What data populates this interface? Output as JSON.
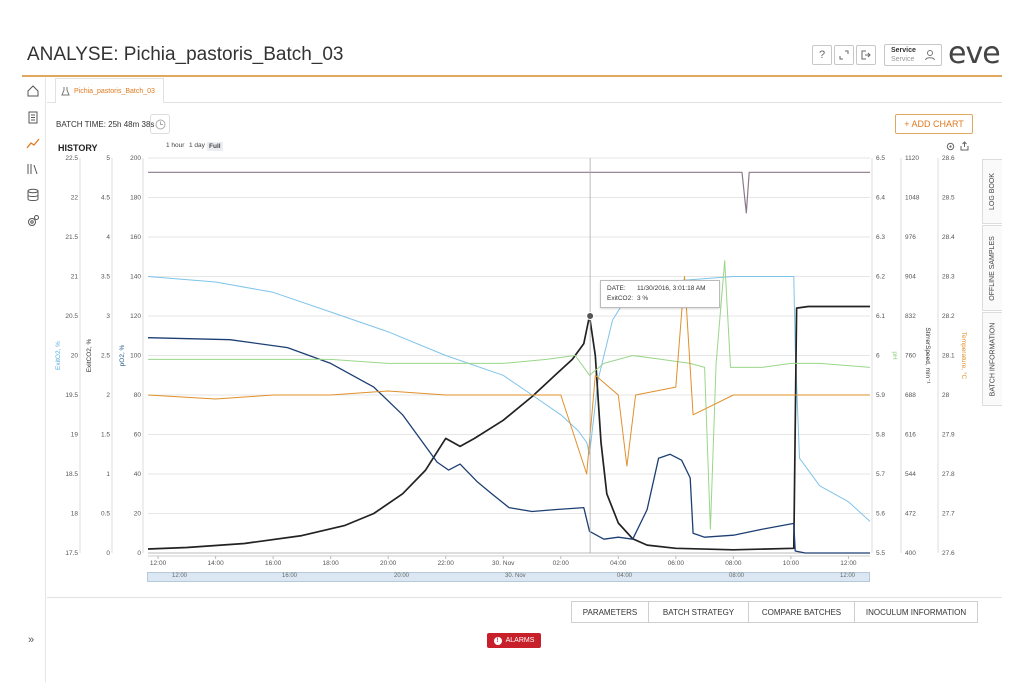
{
  "header": {
    "title": "ANALYSE: Pichia_pastoris_Batch_03",
    "help_label": "?",
    "user_name": "Service",
    "user_role": "Service",
    "logo": "eve",
    "accent_color": "#e0a85e"
  },
  "tabs": [
    {
      "label": "Pichia_pastoris_Batch_03"
    }
  ],
  "toolbar": {
    "batch_time": "BATCH TIME: 25h 48m 38s",
    "add_chart_label": "+ ADD CHART"
  },
  "chart_panel": {
    "title": "HISTORY",
    "ranges": [
      "1 hour",
      "1 day",
      "Full"
    ],
    "selected_range": "Full"
  },
  "tooltip": {
    "date_key": "DATE:",
    "date_value": "11/30/2016, 3:01:18 AM",
    "series_key": "ExitCO2:",
    "series_value": "3 %"
  },
  "side_tabs": [
    "LOG BOOK",
    "OFFLINE SAMPLES",
    "BATCH INFORMATION"
  ],
  "bottom_buttons": [
    "PARAMETERS",
    "BATCH STRATEGY",
    "COMPARE BATCHES",
    "INOCULUM INFORMATION"
  ],
  "alarms_label": "ALARMS",
  "chart_data": {
    "type": "line",
    "x_tick_labels": [
      "12:00",
      "14:00",
      "16:00",
      "18:00",
      "20:00",
      "22:00",
      "30. Nov",
      "02:00",
      "04:00",
      "06:00",
      "08:00",
      "10:00",
      "12:00"
    ],
    "x_ticks_hours": [
      12,
      14,
      16,
      18,
      20,
      22,
      24,
      26,
      28,
      30,
      32,
      34,
      36
    ],
    "x_range_hours": [
      11.65,
      36.75
    ],
    "navigator_labels": [
      "12:00",
      "16:00",
      "20:00",
      "30. Nov",
      "04:00",
      "08:00",
      "12:00"
    ],
    "axes": [
      {
        "id": "exito2",
        "label": "ExitO2, %",
        "color": "#5aaee0",
        "range": [
          17.5,
          22.5
        ],
        "ticks": [
          "17.5",
          "18",
          "18.5",
          "19",
          "19.5",
          "20",
          "20.5",
          "21",
          "21.5",
          "22",
          "22.5"
        ]
      },
      {
        "id": "exitco2",
        "label": "ExitCO2, %",
        "color": "#333333",
        "range": [
          0,
          5
        ],
        "ticks": [
          "0",
          "0.5",
          "1",
          "1.5",
          "2",
          "2.5",
          "3",
          "3.5",
          "4",
          "4.5",
          "5"
        ]
      },
      {
        "id": "po2",
        "label": "pO2, %",
        "color": "#2a5a8c",
        "range": [
          0,
          200
        ],
        "ticks": [
          "0",
          "20",
          "40",
          "60",
          "80",
          "100",
          "120",
          "140",
          "160",
          "180",
          "200"
        ]
      },
      {
        "id": "ph",
        "label": "pH",
        "color": "#8fd27a",
        "range": [
          5.5,
          6.5
        ],
        "ticks": [
          "5.5",
          "5.6",
          "5.7",
          "5.8",
          "5.9",
          "6",
          "6.1",
          "6.2",
          "6.3",
          "6.4",
          "6.5"
        ]
      },
      {
        "id": "stirrer",
        "label": "StirrerSpeed, min⁻¹",
        "color": "#333333",
        "range": [
          400,
          1120
        ],
        "ticks": [
          "400",
          "472",
          "544",
          "616",
          "688",
          "760",
          "832",
          "904",
          "976",
          "1048",
          "1120"
        ]
      },
      {
        "id": "temp",
        "label": "Temperature, °C",
        "color": "#e0902a",
        "range": [
          27.6,
          28.6
        ],
        "ticks": [
          "27.6",
          "27.7",
          "27.8",
          "27.9",
          "28",
          "28.1",
          "28.2",
          "28.3",
          "28.4",
          "28.5",
          "28.6"
        ]
      }
    ],
    "series": [
      {
        "name": "ExitO2",
        "axis": "exito2",
        "color": "#7fc4ea",
        "width": 1,
        "points": [
          [
            11.65,
            21.0
          ],
          [
            14,
            20.93
          ],
          [
            16,
            20.8
          ],
          [
            18,
            20.55
          ],
          [
            20,
            20.3
          ],
          [
            22,
            20.0
          ],
          [
            24,
            19.75
          ],
          [
            25,
            19.5
          ],
          [
            26,
            19.25
          ],
          [
            26.6,
            19.05
          ],
          [
            26.9,
            18.9
          ],
          [
            27.0,
            18.75
          ],
          [
            27.3,
            19.7
          ],
          [
            27.8,
            20.45
          ],
          [
            28.4,
            20.8
          ],
          [
            29.2,
            20.92
          ],
          [
            30.5,
            20.96
          ],
          [
            32,
            21.0
          ],
          [
            34.1,
            21.0
          ],
          [
            34.15,
            20.1
          ],
          [
            34.3,
            18.7
          ],
          [
            35.0,
            18.35
          ],
          [
            36.0,
            18.15
          ],
          [
            36.75,
            17.9
          ]
        ]
      },
      {
        "name": "ExitCO2",
        "axis": "exitco2",
        "color": "#222222",
        "width": 1.7,
        "points": [
          [
            11.65,
            0.05
          ],
          [
            13,
            0.07
          ],
          [
            15,
            0.12
          ],
          [
            17,
            0.22
          ],
          [
            18.5,
            0.35
          ],
          [
            19.5,
            0.5
          ],
          [
            20.5,
            0.75
          ],
          [
            21.3,
            1.05
          ],
          [
            22,
            1.45
          ],
          [
            22.5,
            1.35
          ],
          [
            23,
            1.45
          ],
          [
            24,
            1.68
          ],
          [
            25,
            1.98
          ],
          [
            25.8,
            2.25
          ],
          [
            26.4,
            2.45
          ],
          [
            26.8,
            2.65
          ],
          [
            27.0,
            3.0
          ],
          [
            27.2,
            2.5
          ],
          [
            27.4,
            1.4
          ],
          [
            27.6,
            0.75
          ],
          [
            28.0,
            0.38
          ],
          [
            28.5,
            0.18
          ],
          [
            29.0,
            0.1
          ],
          [
            30,
            0.06
          ],
          [
            32,
            0.04
          ],
          [
            34.1,
            0.06
          ],
          [
            34.2,
            3.1
          ],
          [
            34.6,
            3.12
          ],
          [
            36.75,
            3.12
          ]
        ]
      },
      {
        "name": "pO2",
        "axis": "po2",
        "color": "#1d3f73",
        "width": 1.3,
        "points": [
          [
            11.65,
            109
          ],
          [
            14.5,
            108
          ],
          [
            16.5,
            104
          ],
          [
            18,
            96
          ],
          [
            19.5,
            84
          ],
          [
            20.5,
            70
          ],
          [
            21.2,
            56
          ],
          [
            21.7,
            46
          ],
          [
            22.1,
            42
          ],
          [
            22.5,
            45
          ],
          [
            23.1,
            36
          ],
          [
            23.6,
            30
          ],
          [
            24.2,
            23
          ],
          [
            25,
            21
          ],
          [
            25.8,
            22
          ],
          [
            26.8,
            23
          ],
          [
            27.0,
            11
          ],
          [
            27.5,
            7
          ],
          [
            28.0,
            8
          ],
          [
            28.5,
            7
          ],
          [
            29.0,
            22
          ],
          [
            29.4,
            48
          ],
          [
            29.8,
            50
          ],
          [
            30.2,
            47
          ],
          [
            30.5,
            38
          ],
          [
            30.6,
            10
          ],
          [
            31,
            8
          ],
          [
            32,
            9
          ],
          [
            33,
            12
          ],
          [
            34.1,
            15
          ],
          [
            34.15,
            1
          ],
          [
            34.5,
            0
          ],
          [
            36.75,
            0
          ]
        ]
      },
      {
        "name": "pH",
        "axis": "ph",
        "color": "#9ad68a",
        "width": 1,
        "points": [
          [
            11.65,
            5.99
          ],
          [
            14,
            5.99
          ],
          [
            16,
            5.99
          ],
          [
            18,
            5.99
          ],
          [
            20,
            5.98
          ],
          [
            22,
            5.98
          ],
          [
            24,
            5.98
          ],
          [
            25.5,
            5.99
          ],
          [
            26.5,
            6.0
          ],
          [
            27.0,
            5.95
          ],
          [
            27.5,
            5.98
          ],
          [
            28.5,
            6.0
          ],
          [
            29.5,
            5.99
          ],
          [
            30.5,
            5.98
          ],
          [
            31.0,
            5.97
          ],
          [
            31.2,
            5.56
          ],
          [
            31.4,
            5.98
          ],
          [
            31.7,
            6.24
          ],
          [
            31.9,
            5.97
          ],
          [
            33,
            5.97
          ],
          [
            34,
            5.98
          ],
          [
            35,
            5.98
          ],
          [
            36.75,
            5.97
          ]
        ]
      },
      {
        "name": "StirrerSpeed",
        "axis": "stirrer",
        "color": "#8a7a8a",
        "width": 1.2,
        "points": [
          [
            11.65,
            1094
          ],
          [
            32.3,
            1094
          ],
          [
            32.45,
            1020
          ],
          [
            32.55,
            1094
          ],
          [
            36.75,
            1094
          ]
        ]
      },
      {
        "name": "Temperature",
        "axis": "temp",
        "color": "#e0902a",
        "width": 1,
        "points": [
          [
            11.65,
            28.0
          ],
          [
            14,
            27.99
          ],
          [
            16,
            28.0
          ],
          [
            18,
            28.0
          ],
          [
            20,
            28.01
          ],
          [
            22,
            28.0
          ],
          [
            24,
            28.0
          ],
          [
            26,
            28.0
          ],
          [
            26.9,
            27.8
          ],
          [
            27.2,
            28.05
          ],
          [
            28.0,
            28.0
          ],
          [
            28.3,
            27.82
          ],
          [
            28.6,
            28.0
          ],
          [
            30.0,
            28.02
          ],
          [
            30.3,
            28.3
          ],
          [
            30.6,
            27.95
          ],
          [
            32,
            28.0
          ],
          [
            34,
            28.0
          ],
          [
            36.75,
            28.0
          ]
        ]
      }
    ],
    "cursor_x": 27.02,
    "marker": {
      "series": "ExitCO2",
      "x": 27.02,
      "y": 3
    }
  }
}
